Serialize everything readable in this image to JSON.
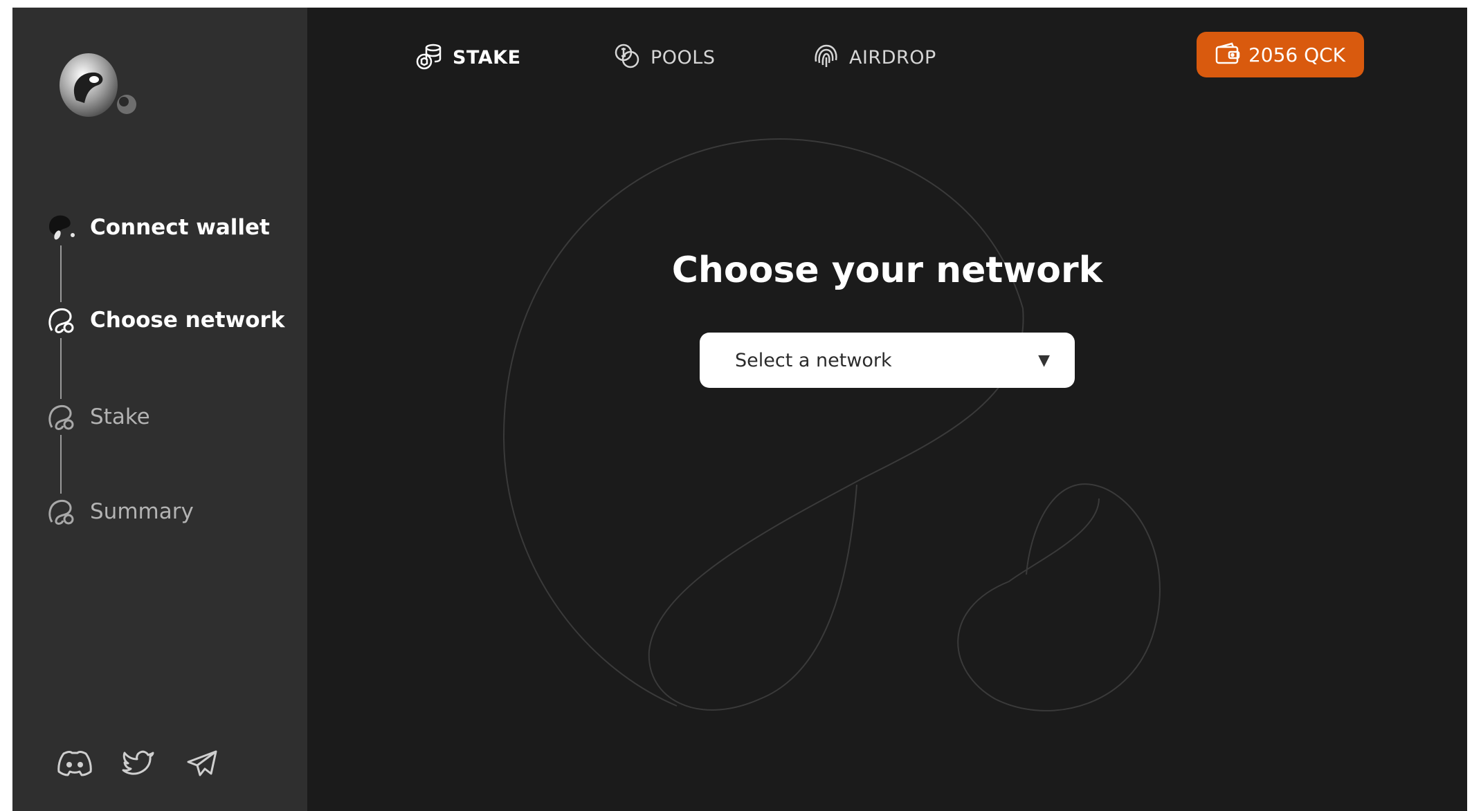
{
  "nav": [
    {
      "label": "STAKE",
      "icon": "stake-icon",
      "active": true
    },
    {
      "label": "POOLS",
      "icon": "pools-icon",
      "active": false
    },
    {
      "label": "AIRDROP",
      "icon": "airdrop-icon",
      "active": false
    }
  ],
  "balance": {
    "label": "2056 QCK",
    "icon": "wallet-icon",
    "color": "#d95a0e"
  },
  "steps": [
    {
      "label": "Connect wallet",
      "state": "done"
    },
    {
      "label": "Choose network",
      "state": "active"
    },
    {
      "label": "Stake",
      "state": "pending"
    },
    {
      "label": "Summary",
      "state": "pending"
    }
  ],
  "main": {
    "title": "Choose your network",
    "select_value": "Select a network",
    "caret": "▼"
  },
  "socials": [
    {
      "icon": "discord-icon"
    },
    {
      "icon": "twitter-icon"
    },
    {
      "icon": "telegram-icon"
    }
  ],
  "colors": {
    "background": "#1b1b1b",
    "sidebar": "#2f2f2f",
    "accent": "#d95a0e"
  }
}
